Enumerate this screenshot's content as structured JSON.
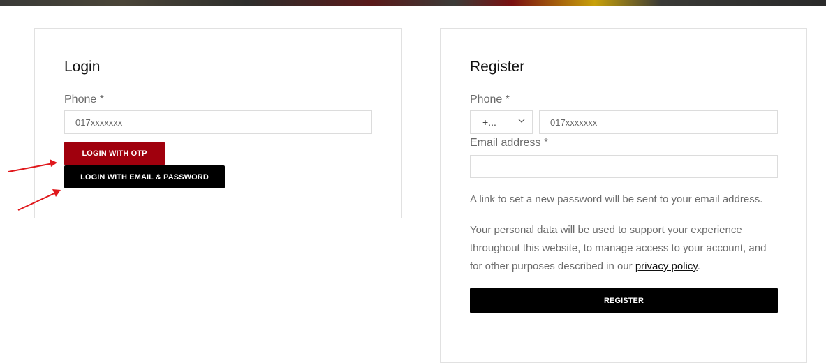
{
  "login": {
    "title": "Login",
    "phone_label": "Phone *",
    "phone_placeholder": "017xxxxxxx",
    "otp_button": "LOGIN WITH OTP",
    "email_button": "LOGIN WITH EMAIL & PASSWORD"
  },
  "register": {
    "title": "Register",
    "phone_label": "Phone *",
    "country_code": "+...",
    "phone_placeholder": "017xxxxxxx",
    "email_label": "Email address *",
    "email_value": "",
    "password_note": "A link to set a new password will be sent to your email address.",
    "privacy_text_before": "Your personal data will be used to support your experience throughout this website, to manage access to your account, and for other purposes described in our ",
    "privacy_link": "privacy policy",
    "privacy_text_after": ".",
    "register_button": "REGISTER"
  },
  "colors": {
    "otp_button_bg": "#a0000d",
    "dark_button_bg": "#000000",
    "annotation_arrow": "#e0181c"
  },
  "icons": {
    "country_dropdown": "chevron-down-icon",
    "annotations": [
      "red-arrow-icon",
      "red-arrow-icon"
    ]
  }
}
